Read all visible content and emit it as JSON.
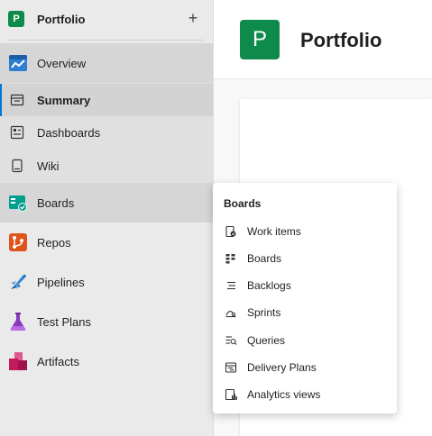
{
  "project": {
    "avatar_letter": "P",
    "name": "Portfolio",
    "add_label": "+"
  },
  "nav": {
    "overview": "Overview",
    "summary": "Summary",
    "dashboards": "Dashboards",
    "wiki": "Wiki",
    "boards": "Boards",
    "repos": "Repos",
    "pipelines": "Pipelines",
    "test_plans": "Test Plans",
    "artifacts": "Artifacts"
  },
  "main": {
    "avatar_letter": "P",
    "title": "Portfolio"
  },
  "flyout": {
    "title": "Boards",
    "items": [
      {
        "label": "Work items",
        "icon": "work-items-icon"
      },
      {
        "label": "Boards",
        "icon": "boards-icon"
      },
      {
        "label": "Backlogs",
        "icon": "backlogs-icon"
      },
      {
        "label": "Sprints",
        "icon": "sprints-icon"
      },
      {
        "label": "Queries",
        "icon": "queries-icon"
      },
      {
        "label": "Delivery Plans",
        "icon": "delivery-plans-icon"
      },
      {
        "label": "Analytics views",
        "icon": "analytics-views-icon"
      }
    ]
  },
  "colors": {
    "project_green": "#0e8a4a",
    "accent_blue": "#0078d4",
    "boards_teal": "#009e8e",
    "repos_orange": "#e0531b",
    "pipelines_blue": "#2e7fd1",
    "testplans_purple": "#8a3bbd",
    "artifacts_pink": "#c3195d"
  }
}
